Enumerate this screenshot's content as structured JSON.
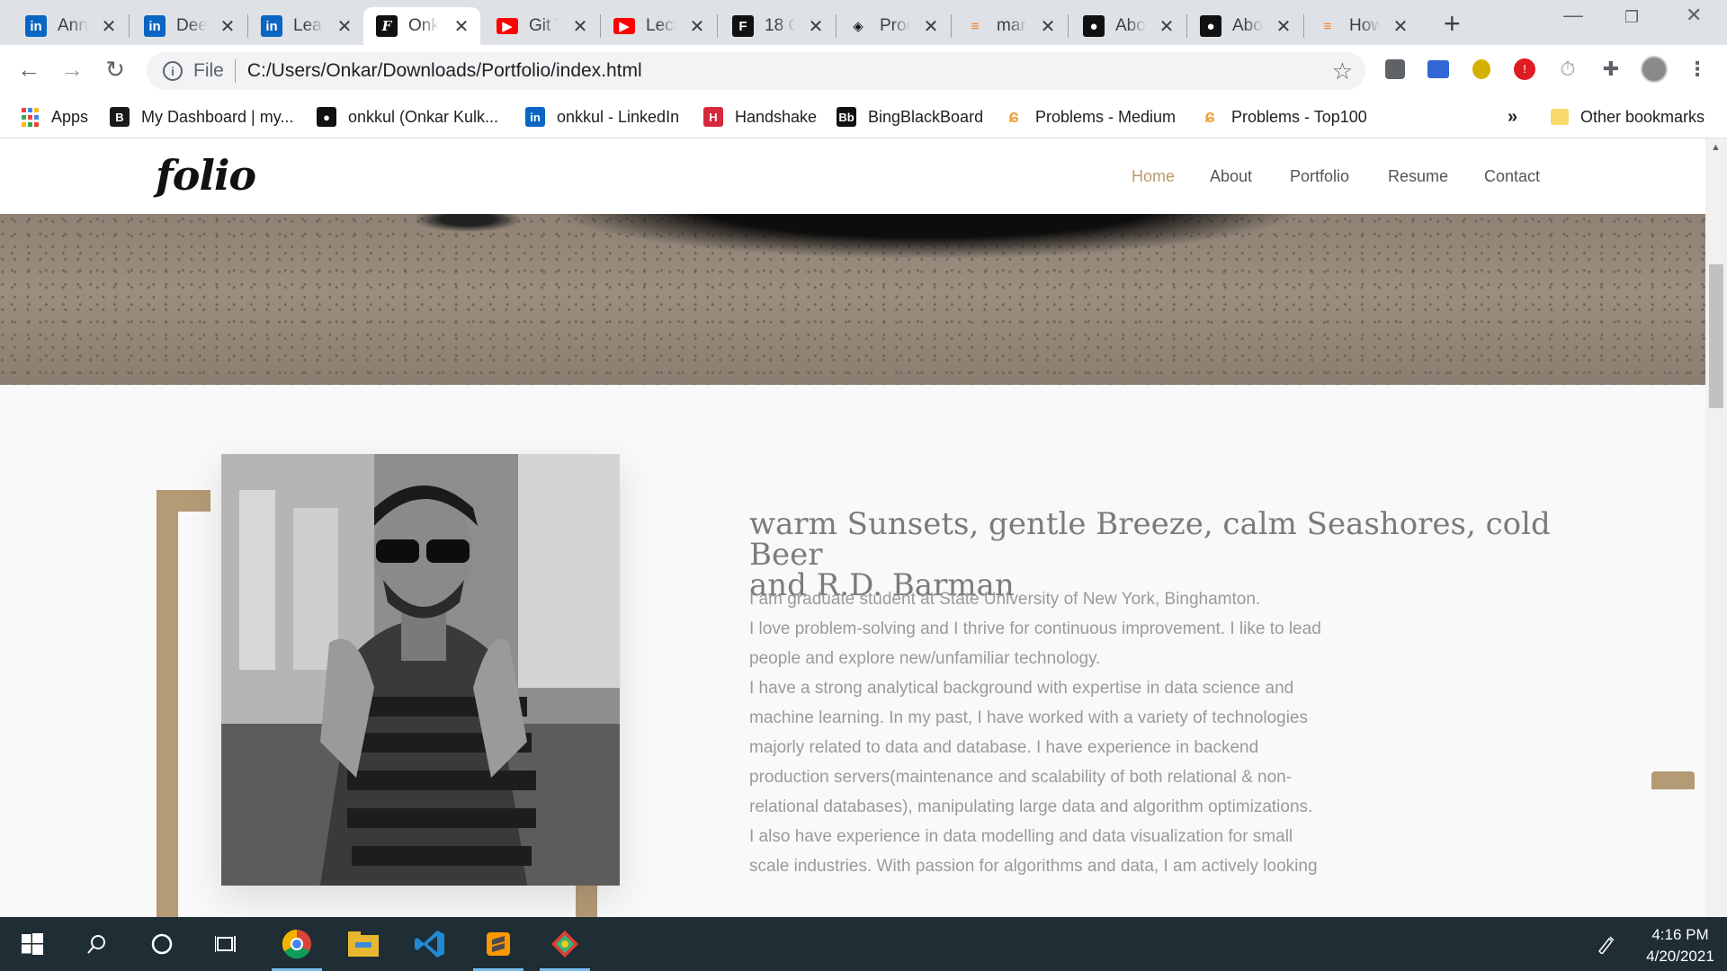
{
  "browser": {
    "tabs": [
      {
        "title": "Annu",
        "icon": "linkedin-icon",
        "glyph": "in",
        "kind": "li",
        "active": false
      },
      {
        "title": "Deep",
        "icon": "linkedin-icon",
        "glyph": "in",
        "kind": "li",
        "active": false
      },
      {
        "title": "Leah",
        "icon": "linkedin-icon",
        "glyph": "in",
        "kind": "li",
        "active": false
      },
      {
        "title": "Onk",
        "icon": "folio-icon",
        "glyph": "F",
        "kind": "f",
        "active": true
      },
      {
        "title": "Git T",
        "icon": "youtube-icon",
        "glyph": "▶",
        "kind": "yt",
        "active": false
      },
      {
        "title": "Lect",
        "icon": "youtube-icon",
        "glyph": "▶",
        "kind": "yt",
        "active": false
      },
      {
        "title": "18 C",
        "icon": "framer-icon",
        "glyph": "F",
        "kind": "fb",
        "active": false
      },
      {
        "title": "Prog",
        "icon": "codepen-icon",
        "glyph": "◈",
        "kind": "cp",
        "active": false
      },
      {
        "title": "mar",
        "icon": "stackoverflow-icon",
        "glyph": "≡",
        "kind": "so",
        "active": false
      },
      {
        "title": "Abo",
        "icon": "github-icon",
        "glyph": "●",
        "kind": "gh",
        "active": false
      },
      {
        "title": "Abo",
        "icon": "github-icon",
        "glyph": "●",
        "kind": "gh",
        "active": false
      },
      {
        "title": "How",
        "icon": "stackoverflow-icon",
        "glyph": "≡",
        "kind": "so",
        "active": false
      }
    ],
    "address": {
      "scheme": "File",
      "url": "C:/Users/Onkar/Downloads/Portfolio/index.html"
    },
    "bookmarks": [
      {
        "label": "Apps",
        "icon": "apps-grid-icon"
      },
      {
        "label": "My Dashboard | my...",
        "icon": "dashboard-icon",
        "glyph": "B",
        "color": "#1a1a1a"
      },
      {
        "label": "onkkul (Onkar Kulk...",
        "icon": "github-icon",
        "glyph": "●",
        "color": "#111111"
      },
      {
        "label": "onkkul - LinkedIn",
        "icon": "linkedin-icon",
        "glyph": "in",
        "color": "#0a66c2"
      },
      {
        "label": "Handshake",
        "icon": "handshake-icon",
        "glyph": "H",
        "color": "#d6283d"
      },
      {
        "label": "BingBlackBoard",
        "icon": "blackboard-icon",
        "glyph": "Bb",
        "color": "#111111"
      },
      {
        "label": "Problems - Medium",
        "icon": "leetcode-icon",
        "glyph": "ɕ",
        "color": "#ffffff"
      },
      {
        "label": "Problems - Top100",
        "icon": "leetcode-icon",
        "glyph": "ɕ",
        "color": "#ffffff"
      }
    ],
    "overflow": "»",
    "other_bookmarks": "Other bookmarks"
  },
  "site": {
    "logo": "folio",
    "nav": [
      {
        "label": "Home",
        "active": true
      },
      {
        "label": "About",
        "active": false
      },
      {
        "label": "Portfolio",
        "active": false
      },
      {
        "label": "Resume",
        "active": false
      },
      {
        "label": "Contact",
        "active": false
      }
    ],
    "accent_color": "#bc9a6c"
  },
  "about": {
    "heading_line1": "warm Sunsets, gentle Breeze, calm Seashores, cold Beer",
    "heading_line2": "and R.D. Barman",
    "lines": [
      "I am graduate student at State University of New York, Binghamton.",
      "I love problem-solving and I thrive for continuous improvement. I like to lead",
      "people and explore new/unfamiliar technology.",
      "I have a strong analytical background with expertise in data science and",
      "machine learning. In my past, I have worked with a variety of technologies",
      "majorly related to data and database. I have experience in backend",
      "production servers(maintenance and scalability of both relational & non-",
      "relational databases), manipulating large data and algorithm optimizations.",
      "I also have experience in data modelling and data visualization for small",
      "scale industries. With passion for algorithms and data, I am actively looking"
    ]
  },
  "taskbar": {
    "time": "4:16 PM",
    "date": "4/20/2021"
  }
}
